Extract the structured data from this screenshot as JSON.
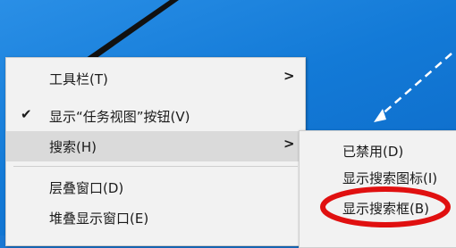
{
  "context_menu": {
    "items": [
      {
        "label": "工具栏(T)",
        "has_submenu": true
      },
      {
        "label": "显示“任务视图”按钮(V)",
        "checked": true
      },
      {
        "label": "搜索(H)",
        "has_submenu": true,
        "highlighted": true
      },
      {
        "label": "层叠窗口(D)"
      },
      {
        "label": "堆叠显示窗口(E)"
      }
    ],
    "check_glyph": "✔",
    "arrow_glyph": ">"
  },
  "search_submenu": {
    "items": [
      {
        "label": "已禁用(D)"
      },
      {
        "label": "显示搜索图标(I)"
      },
      {
        "label": "显示搜索框(B)",
        "annotated": true
      }
    ]
  },
  "colors": {
    "desktop": "#1a78d4",
    "menu_bg": "#f2f2f2",
    "highlight": "#dadada",
    "annotation": "#e01010"
  }
}
